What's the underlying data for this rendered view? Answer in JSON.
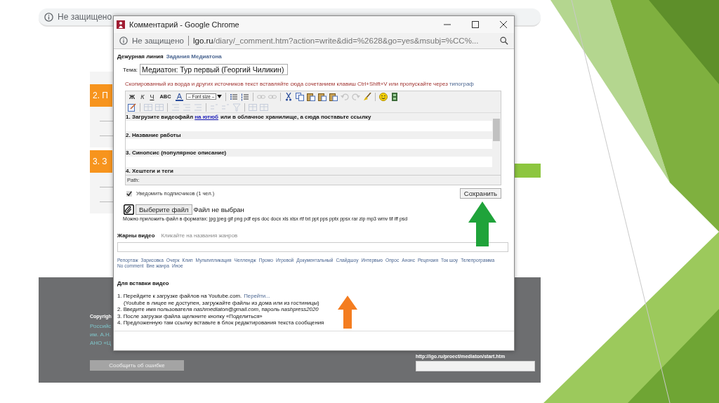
{
  "background_page": {
    "security": "Не защищено",
    "sections": [
      {
        "label": "2. П"
      },
      {
        "label": "3. З"
      }
    ],
    "footer": {
      "copyright": "Copyrigh",
      "lines": [
        "Российс",
        "им. А.Н.",
        "АНО «Ц"
      ],
      "url": "http://lgo.ru/proect/mediaton/start.htm",
      "report_button": "Сообщить об ошибке"
    }
  },
  "window": {
    "title": "Комментарий - Google Chrome",
    "security": "Не защищено",
    "url_host": "lgo.ru",
    "url_path": "/diary/_comment.htm?action=write&did=%2628&go=yes&msubj=%CC%..."
  },
  "breadcrumb": {
    "section": "Дежурная линия",
    "link": "Задания Медиатона"
  },
  "topic": {
    "label": "Тема:",
    "value": "Медиатон: Тур первый (Георгий Чиликин)"
  },
  "paste_note": {
    "text": "Скопированный из ворда и других источников текст вставляйте сюда сочетанием клавиш Ctrl+Shift+V или пропускайте через",
    "link": "типограф"
  },
  "toolbar": {
    "format_buttons": [
      "Ж",
      "К",
      "Ч",
      "ABC",
      "A"
    ],
    "font_size": "– Font size –",
    "row1_groups": [
      [
        {
          "kind": "bullets",
          "disabled": false
        },
        {
          "kind": "numbers",
          "disabled": false
        }
      ],
      [
        {
          "kind": "link",
          "disabled": true
        },
        {
          "kind": "unlink",
          "disabled": true
        }
      ],
      [
        {
          "kind": "cut",
          "disabled": false
        },
        {
          "kind": "copy",
          "disabled": false
        },
        {
          "kind": "paste",
          "disabled": false
        },
        {
          "kind": "paste",
          "disabled": false
        },
        {
          "kind": "paste",
          "disabled": false
        },
        {
          "kind": "undo",
          "disabled": true
        },
        {
          "kind": "redo",
          "disabled": true
        },
        {
          "kind": "brush",
          "disabled": false
        }
      ],
      [
        {
          "kind": "smiley",
          "disabled": false
        },
        {
          "kind": "film",
          "disabled": false
        }
      ]
    ],
    "row2_groups": [
      [
        {
          "kind": "edit",
          "disabled": false
        }
      ],
      [
        {
          "kind": "table",
          "disabled": true
        },
        {
          "kind": "table",
          "disabled": true
        }
      ],
      [
        {
          "kind": "indent",
          "disabled": true
        },
        {
          "kind": "indent",
          "disabled": true
        },
        {
          "kind": "indent",
          "disabled": true
        }
      ],
      [
        {
          "kind": "superscript",
          "disabled": true
        },
        {
          "kind": "superscript",
          "disabled": true
        },
        {
          "kind": "filter",
          "disabled": true
        }
      ],
      [
        {
          "kind": "table",
          "disabled": true
        },
        {
          "kind": "table",
          "disabled": true
        }
      ]
    ]
  },
  "editor": {
    "lines": [
      {
        "text": "1. Загрузите видеофайл",
        "link": "на ютюб",
        "after": "или в облачное хранилище, а сюда поставьте ссылку"
      },
      {
        "text": "2. Название работы"
      },
      {
        "text": "3. Синопсис (популярное описание)"
      },
      {
        "text": "4. Хештеги и теги"
      }
    ],
    "path_label": "Path:"
  },
  "notify": {
    "label": "Уведомить подписчиков (1 чел.)",
    "checked": true
  },
  "save_button": "Сохранить",
  "attachment": {
    "button": "Выберите файл",
    "status": "Файл не выбран",
    "formats": "Можно приложить файл в форматах: jpg jpeg gif png pdf eps doc docx xls xlsx rtf txt ppt pps pptx ppsx rar zip mp3 wmv tif iff psd"
  },
  "genres": {
    "title": "Жарны видео",
    "hint": "Кликайте на названия жанров",
    "items": [
      "Репортаж",
      "Зарисовка",
      "Очерк",
      "Клип",
      "Мультипликация",
      "Челлендж",
      "Промо",
      "Игровой",
      "Документальный",
      "Слайдшоу",
      "Интервью",
      "Опрос",
      "Анонс",
      "Рецензия",
      "Ток шоу",
      "Телепрограмма",
      "No comment",
      "Вне жанра",
      "Иное"
    ]
  },
  "video_help": {
    "title": "Для вставки видео",
    "steps": [
      {
        "text": "1. Перейдите к загрузке файлов на Youtube.com.",
        "link": "Перейти...",
        "indent": false
      },
      {
        "text": "(Youtube в лицее не доступен, загружайте файлы из дома или из гостиницы)",
        "indent": true
      },
      {
        "text": "2. Введите имя пользователя *nashmediaton@gmail.com*, пароль *nashpress2020*",
        "indent": false
      },
      {
        "text": "3. После загрузки файла щелкните кнопку «Поделиться»",
        "indent": false
      },
      {
        "text": "4. Предложенную там ссылку вставьте в блок редактирования текста сообщения",
        "indent": false
      }
    ]
  }
}
